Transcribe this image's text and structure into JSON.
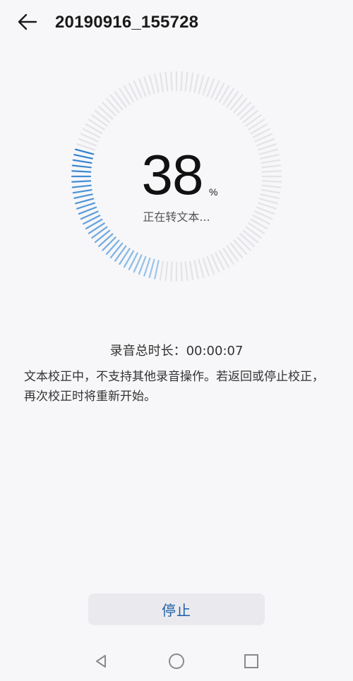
{
  "header": {
    "title": "20190916_155728"
  },
  "progress": {
    "value": 38,
    "unit": "%",
    "status": "正在转文本..."
  },
  "recording": {
    "duration_label": "录音总时长：00:00:07"
  },
  "notice": {
    "text": "文本校正中，不支持其他录音操作。若返回或停止校正，再次校正时将重新开始。"
  },
  "actions": {
    "stop_label": "停止"
  },
  "colors": {
    "background": "#f7f7f9",
    "accent_blue": "#2f7fd0",
    "tick_inactive": "#e3e3e8",
    "button_text": "#1f5fa8"
  },
  "icons": {
    "back": "arrow-left-icon",
    "nav_back": "triangle-left-icon",
    "nav_home": "circle-icon",
    "nav_recent": "square-icon"
  }
}
